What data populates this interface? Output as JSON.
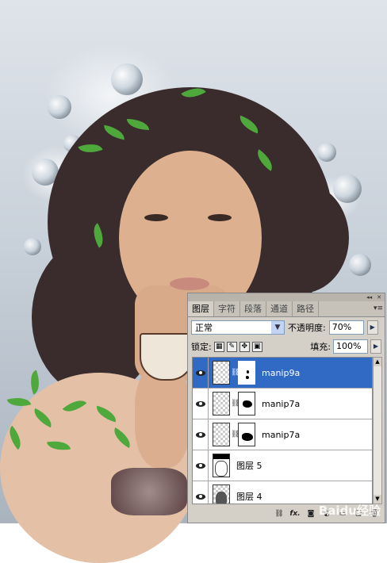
{
  "panel": {
    "tabs": [
      {
        "label": "图层"
      },
      {
        "label": "字符"
      },
      {
        "label": "段落"
      },
      {
        "label": "通道"
      },
      {
        "label": "路径"
      }
    ],
    "blend_mode": "正常",
    "opacity_label": "不透明度:",
    "opacity_value": "70%",
    "lock_label": "锁定:",
    "fill_label": "填充:",
    "fill_value": "100%",
    "layers": [
      {
        "name": "manip9a"
      },
      {
        "name": "manip7a"
      },
      {
        "name": "manip7a"
      },
      {
        "name": "图层 5"
      },
      {
        "name": "图层 4"
      }
    ],
    "footer_icons": [
      "link-icon",
      "fx-icon",
      "mask-icon",
      "adjustment-icon",
      "group-icon",
      "new-layer-icon",
      "trash-icon"
    ]
  },
  "colors": {
    "selection": "#316ac5",
    "panel_bg": "#d4d0c8"
  },
  "watermark": "Baidu经验"
}
